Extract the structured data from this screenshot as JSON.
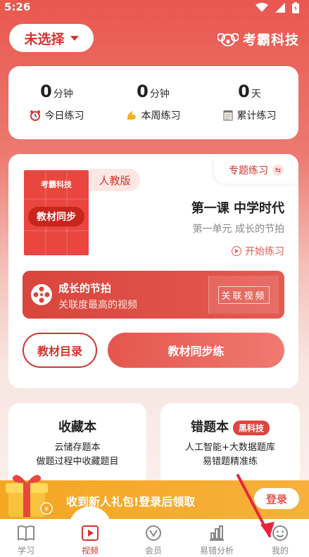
{
  "status_bar": {
    "time": "5:26"
  },
  "header": {
    "select_label": "未选择",
    "brand": "考霸科技"
  },
  "stats": [
    {
      "value": "0",
      "unit": "分钟",
      "label": "今日练习",
      "icon": "alarm-clock-icon"
    },
    {
      "value": "0",
      "unit": "分钟",
      "label": "本周练习",
      "icon": "flexed-arm-icon"
    },
    {
      "value": "0",
      "unit": "天",
      "label": "累计练习",
      "icon": "notepad-icon"
    }
  ],
  "textbook": {
    "topic_practice": "专题练习",
    "cover_brand": "考霸科技",
    "cover_tag": "教材同步",
    "edition": "人教版",
    "lesson_title": "第一课 中学时代",
    "lesson_sub": "第一单元 成长的节拍",
    "start_practice": "开始练习"
  },
  "video": {
    "title": "成长的节拍",
    "subtitle": "关联度最高的视频",
    "related": "关联视频"
  },
  "buttons": {
    "catalog": "教材目录",
    "sync_practice": "教材同步练"
  },
  "favorites": {
    "title": "收藏本",
    "desc1": "云储存题本",
    "desc2": "做题过程中收藏题目"
  },
  "errors": {
    "title": "错题本",
    "badge": "黑科技",
    "desc1": "人工智能+大数据题库",
    "desc2": "易错题精准练"
  },
  "promo": {
    "text": "收到新人礼包!登录后领取",
    "login": "登录"
  },
  "tabs": [
    {
      "label": "学习",
      "icon": "book-icon"
    },
    {
      "label": "视频",
      "icon": "video-play-icon"
    },
    {
      "label": "会员",
      "icon": "vip-icon"
    },
    {
      "label": "易错分析",
      "icon": "bar-chart-icon"
    },
    {
      "label": "我的",
      "icon": "smiley-icon"
    }
  ],
  "colors": {
    "primary": "#d2352e",
    "accent": "#e4564e",
    "promo": "#f5a623"
  }
}
